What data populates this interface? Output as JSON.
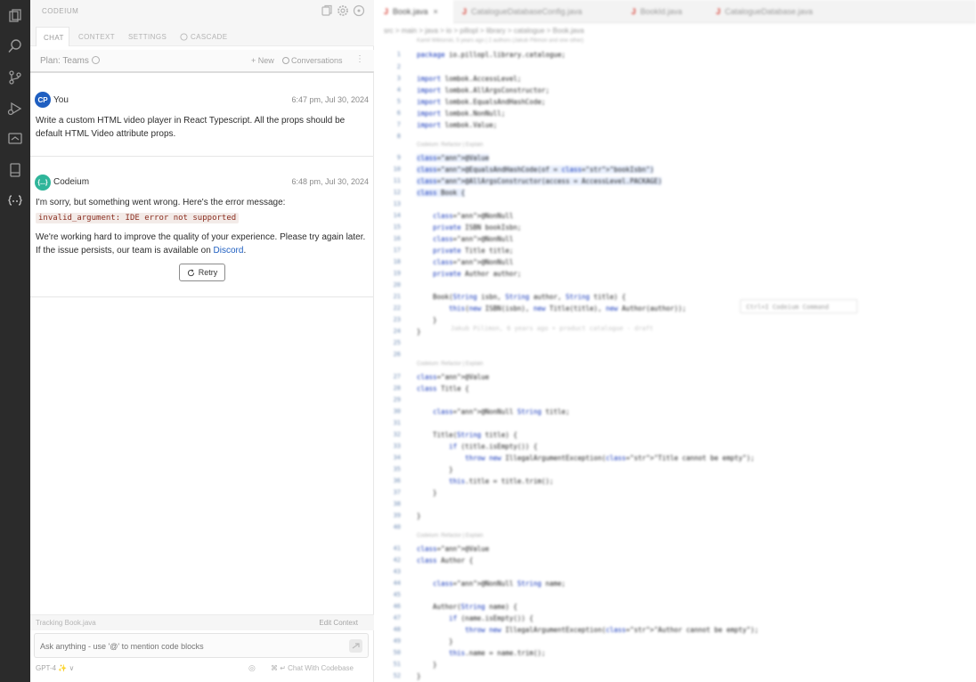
{
  "sidebar": {
    "icons": [
      "files-icon",
      "search-icon",
      "source-control-icon",
      "run-debug-icon",
      "remote-icon",
      "bookmark-icon",
      "codeium-icon"
    ]
  },
  "chat_panel": {
    "title": "CODEIUM",
    "tabs": [
      "CHAT",
      "CONTEXT",
      "SETTINGS",
      "CASCADE"
    ],
    "plan_label": "Plan: Teams",
    "new_label": "+ New",
    "conversations_label": "Conversations",
    "messages": [
      {
        "avatar": "CP",
        "sender": "You",
        "timestamp": "6:47 pm, Jul 30, 2024",
        "text": "Write a custom HTML video player in React Typescript. All the props should be default HTML Video attribute props."
      },
      {
        "avatar": "{...}",
        "sender": "Codeium",
        "timestamp": "6:48 pm, Jul 30, 2024",
        "intro": "I'm sorry, but something went wrong. Here's the error message:",
        "error_code": "invalid_argument: IDE error not supported",
        "body": "We're working hard to improve the quality of your experience. Please try again later. If the issue persists, our team is available on ",
        "link": "Discord",
        "tail": ".",
        "retry_label": "Retry"
      }
    ],
    "tracking_text": "Tracking Book.java",
    "edit_context_label": "Edit Context",
    "input_placeholder": "Ask anything - use '@' to mention code blocks",
    "model_label": "GPT-4 ✨ ∨",
    "chat_with_codebase": "⌘ ↵ Chat With Codebase"
  },
  "editor": {
    "tabs": [
      "Book.java",
      "CatalogueDatabaseConfig.java",
      "BookId.java",
      "CatalogueDatabase.java"
    ],
    "breadcrumb": "src > main > java > io > pillopl > library > catalogue > Book.java",
    "blame_top": "Kamil Wiktorski, 5 years ago | 2 authors (Jakub Pilimon and one other)",
    "codelens": "Codeium: Refactor | Explain",
    "inline_hint": "Ctrl+I Codeium Command",
    "ghost_blame": "Jakub Pilimon, 6 years ago • product catalogue - draft",
    "lines": [
      {
        "n": "1",
        "t": "package io.pillopl.library.catalogue;"
      },
      {
        "n": "2",
        "t": ""
      },
      {
        "n": "3",
        "t": "import lombok.AccessLevel;"
      },
      {
        "n": "4",
        "t": "import lombok.AllArgsConstructor;"
      },
      {
        "n": "5",
        "t": "import lombok.EqualsAndHashCode;"
      },
      {
        "n": "6",
        "t": "import lombok.NonNull;"
      },
      {
        "n": "7",
        "t": "import lombok.Value;"
      },
      {
        "n": "8",
        "t": ""
      },
      {
        "n": "9",
        "t": "@Value"
      },
      {
        "n": "10",
        "t": "@EqualsAndHashCode(of = \"bookIsbn\")"
      },
      {
        "n": "11",
        "t": "@AllArgsConstructor(access = AccessLevel.PACKAGE)"
      },
      {
        "n": "12",
        "t": "class Book {"
      },
      {
        "n": "13",
        "t": ""
      },
      {
        "n": "14",
        "t": "    @NonNull"
      },
      {
        "n": "15",
        "t": "    private ISBN bookIsbn;"
      },
      {
        "n": "16",
        "t": "    @NonNull"
      },
      {
        "n": "17",
        "t": "    private Title title;"
      },
      {
        "n": "18",
        "t": "    @NonNull"
      },
      {
        "n": "19",
        "t": "    private Author author;"
      },
      {
        "n": "20",
        "t": ""
      },
      {
        "n": "21",
        "t": "    Book(String isbn, String author, String title) {"
      },
      {
        "n": "22",
        "t": "        this(new ISBN(isbn), new Title(title), new Author(author));"
      },
      {
        "n": "23",
        "t": "    }"
      },
      {
        "n": "24",
        "t": "}"
      },
      {
        "n": "25",
        "t": ""
      },
      {
        "n": "26",
        "t": ""
      },
      {
        "n": "27",
        "t": "@Value"
      },
      {
        "n": "28",
        "t": "class Title {"
      },
      {
        "n": "29",
        "t": ""
      },
      {
        "n": "30",
        "t": "    @NonNull String title;"
      },
      {
        "n": "31",
        "t": ""
      },
      {
        "n": "32",
        "t": "    Title(String title) {"
      },
      {
        "n": "33",
        "t": "        if (title.isEmpty()) {"
      },
      {
        "n": "34",
        "t": "            throw new IllegalArgumentException(\"Title cannot be empty\");"
      },
      {
        "n": "35",
        "t": "        }"
      },
      {
        "n": "36",
        "t": "        this.title = title.trim();"
      },
      {
        "n": "37",
        "t": "    }"
      },
      {
        "n": "38",
        "t": ""
      },
      {
        "n": "39",
        "t": "}"
      },
      {
        "n": "40",
        "t": ""
      },
      {
        "n": "41",
        "t": "@Value"
      },
      {
        "n": "42",
        "t": "class Author {"
      },
      {
        "n": "43",
        "t": ""
      },
      {
        "n": "44",
        "t": "    @NonNull String name;"
      },
      {
        "n": "45",
        "t": ""
      },
      {
        "n": "46",
        "t": "    Author(String name) {"
      },
      {
        "n": "47",
        "t": "        if (name.isEmpty()) {"
      },
      {
        "n": "48",
        "t": "            throw new IllegalArgumentException(\"Author cannot be empty\");"
      },
      {
        "n": "49",
        "t": "        }"
      },
      {
        "n": "50",
        "t": "        this.name = name.trim();"
      },
      {
        "n": "51",
        "t": "    }"
      },
      {
        "n": "52",
        "t": "}"
      }
    ]
  },
  "colors": {
    "activity_bar": "#2b2b2b",
    "user_avatar": "#1f5fc1",
    "codeium_avatar": "#2fb59a",
    "link": "#1f5fc1",
    "error_bg": "#f3ebe8"
  }
}
